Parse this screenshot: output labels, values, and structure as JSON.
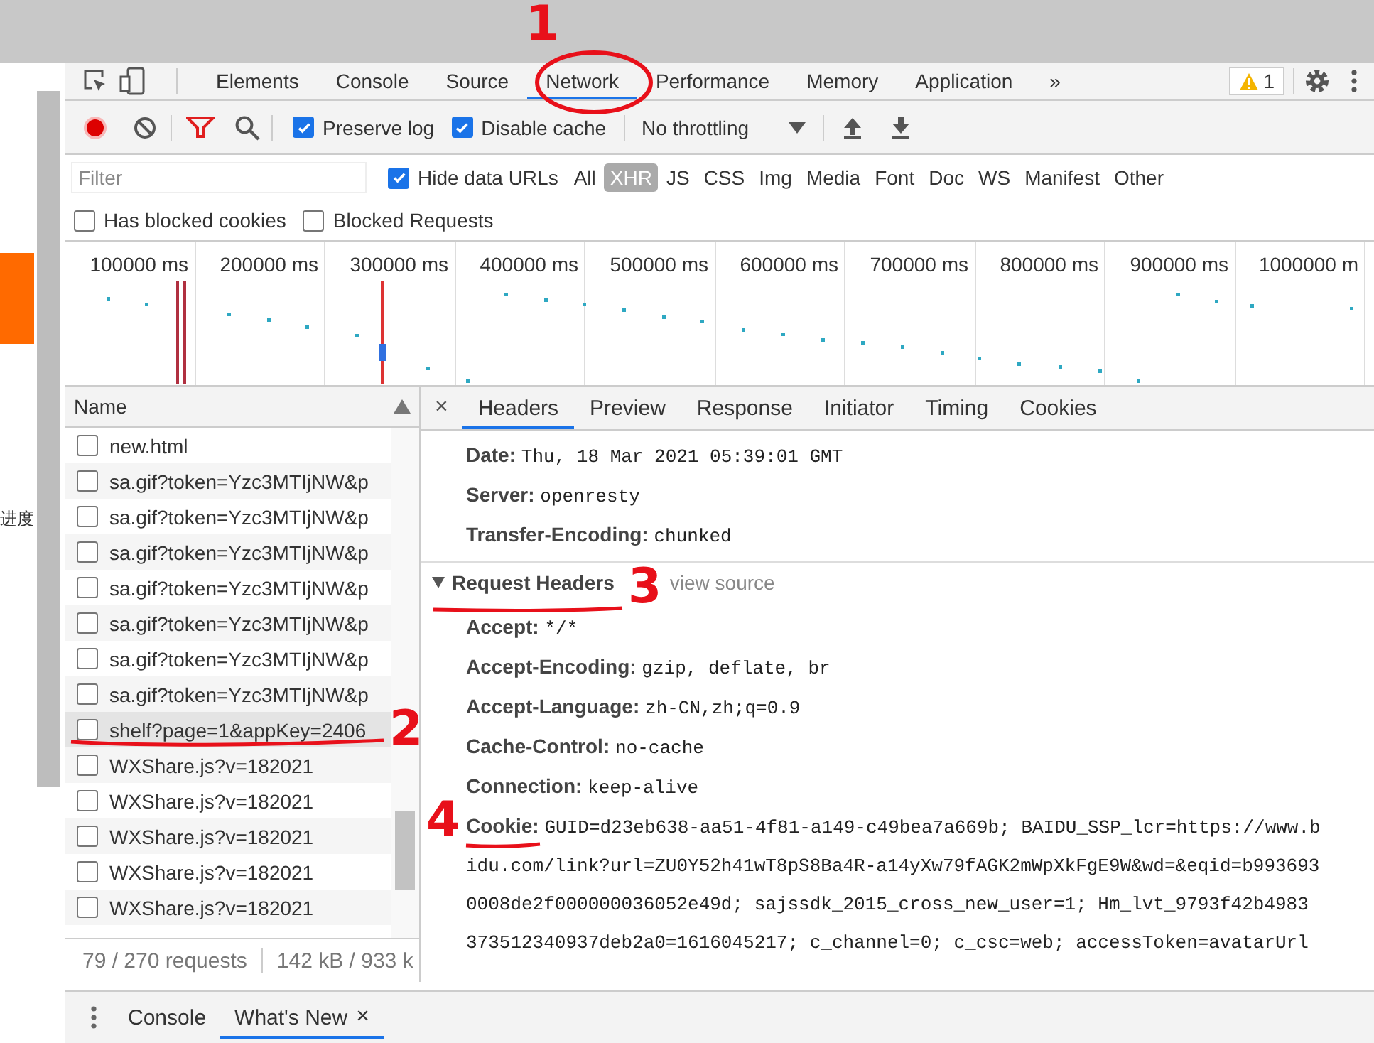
{
  "page_edge": {
    "fragment": "进度"
  },
  "panel_tabs": [
    {
      "label": "Elements",
      "selected": false
    },
    {
      "label": "Console",
      "selected": false
    },
    {
      "label": "Source",
      "selected": false
    },
    {
      "label": "Network",
      "selected": true
    },
    {
      "label": "Performance",
      "selected": false
    },
    {
      "label": "Memory",
      "selected": false
    },
    {
      "label": "Application",
      "selected": false
    }
  ],
  "more_tabs": "»",
  "warning_count": "1",
  "toolbar": {
    "recording": true,
    "preserve_log": {
      "label": "Preserve log",
      "checked": true
    },
    "disable_cache": {
      "label": "Disable cache",
      "checked": true
    },
    "throttling": "No throttling"
  },
  "filter": {
    "placeholder": "Filter",
    "hide_data_urls": {
      "label": "Hide data URLs",
      "checked": true
    },
    "types": [
      {
        "label": "All",
        "selected": false
      },
      {
        "label": "XHR",
        "selected": true
      },
      {
        "label": "JS",
        "selected": false
      },
      {
        "label": "CSS",
        "selected": false
      },
      {
        "label": "Img",
        "selected": false
      },
      {
        "label": "Media",
        "selected": false
      },
      {
        "label": "Font",
        "selected": false
      },
      {
        "label": "Doc",
        "selected": false
      },
      {
        "label": "WS",
        "selected": false
      },
      {
        "label": "Manifest",
        "selected": false
      },
      {
        "label": "Other",
        "selected": false
      }
    ]
  },
  "blocked": [
    {
      "label": "Has blocked cookies",
      "checked": false
    },
    {
      "label": "Blocked Requests",
      "checked": false
    }
  ],
  "overview": {
    "ticks": [
      "100000 ms",
      "200000 ms",
      "300000 ms",
      "400000 ms",
      "500000 ms",
      "600000 ms",
      "700000 ms",
      "800000 ms",
      "900000 ms",
      "1000000 m"
    ]
  },
  "requests": {
    "column": "Name",
    "rows": [
      {
        "name": "new.html",
        "selected": false
      },
      {
        "name": "sa.gif?token=Yzc3MTIjNW&p",
        "selected": false
      },
      {
        "name": "sa.gif?token=Yzc3MTIjNW&p",
        "selected": false
      },
      {
        "name": "sa.gif?token=Yzc3MTIjNW&p",
        "selected": false
      },
      {
        "name": "sa.gif?token=Yzc3MTIjNW&p",
        "selected": false
      },
      {
        "name": "sa.gif?token=Yzc3MTIjNW&p",
        "selected": false
      },
      {
        "name": "sa.gif?token=Yzc3MTIjNW&p",
        "selected": false
      },
      {
        "name": "sa.gif?token=Yzc3MTIjNW&p",
        "selected": false
      },
      {
        "name": "shelf?page=1&appKey=2406",
        "selected": true
      },
      {
        "name": "WXShare.js?v=182021",
        "selected": false
      },
      {
        "name": "WXShare.js?v=182021",
        "selected": false
      },
      {
        "name": "WXShare.js?v=182021",
        "selected": false
      },
      {
        "name": "WXShare.js?v=182021",
        "selected": false
      },
      {
        "name": "WXShare.js?v=182021",
        "selected": false
      }
    ]
  },
  "summary": [
    "79 / 270 requests",
    "142 kB / 933 k"
  ],
  "detail_close": "×",
  "detail_tabs": [
    {
      "label": "Headers",
      "selected": true
    },
    {
      "label": "Preview",
      "selected": false
    },
    {
      "label": "Response",
      "selected": false
    },
    {
      "label": "Initiator",
      "selected": false
    },
    {
      "label": "Timing",
      "selected": false
    },
    {
      "label": "Cookies",
      "selected": false
    }
  ],
  "response_headers": [
    {
      "name": "Date:",
      "value": "Thu, 18 Mar 2021 05:39:01 GMT"
    },
    {
      "name": "Server:",
      "value": "openresty"
    },
    {
      "name": "Transfer-Encoding:",
      "value": "chunked"
    }
  ],
  "request_headers": {
    "title": "Request Headers",
    "expanded": true,
    "view_source": "view source",
    "headers": [
      {
        "name": "Accept:",
        "value": "*/*"
      },
      {
        "name": "Accept-Encoding:",
        "value": "gzip, deflate, br"
      },
      {
        "name": "Accept-Language:",
        "value": "zh-CN,zh;q=0.9"
      },
      {
        "name": "Cache-Control:",
        "value": "no-cache"
      },
      {
        "name": "Connection:",
        "value": "keep-alive"
      },
      {
        "name": "Cookie:",
        "value": "GUID=d23eb638-aa51-4f81-a149-c49bea7a669b; BAIDU_SSP_lcr=https://www.b",
        "more": [
          "idu.com/link?url=ZU0Y52h41wT8pS8Ba4R-a14yXw79fAGK2mWpXkFgE9W&wd=&eqid=b993693",
          "0008de2f000000036052e49d; sajssdk_2015_cross_new_user=1; Hm_lvt_9793f42b4983",
          "373512340937deb2a0=1616045217; c_channel=0; c_csc=web; accessToken=avatarUrl"
        ]
      }
    ]
  },
  "drawer_tabs": [
    {
      "label": "Console",
      "selected": false
    },
    {
      "label": "What's New",
      "selected": true,
      "close": "×"
    }
  ],
  "annotations": [
    {
      "label": "1"
    },
    {
      "label": "2"
    },
    {
      "label": "3"
    },
    {
      "label": "4"
    }
  ]
}
